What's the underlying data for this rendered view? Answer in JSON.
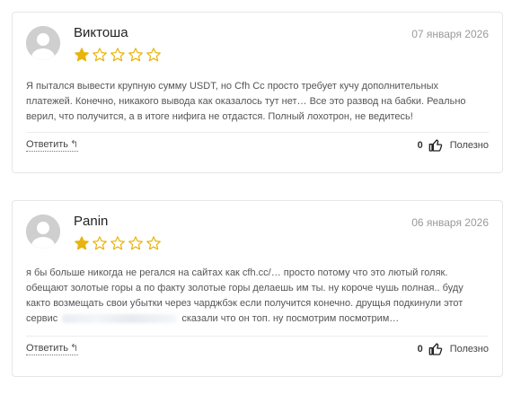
{
  "reviews": [
    {
      "author": "Виктоша",
      "date": "07 января 2026",
      "rating": 1,
      "rating_max": 5,
      "text": "Я пытался вывести крупную сумму USDT, но Cfh Cc просто требует кучу дополнительных платежей. Конечно, никакого вывода как оказалось тут нет… Все это развод на бабки. Реально верил, что получится, а в итоге нифига не отдастся. Полный лохотрон, не ведитесь!",
      "reply_label": "Ответить",
      "helpful_count": "0",
      "helpful_label": "Полезно"
    },
    {
      "author": "Panin",
      "date": "06 января 2026",
      "rating": 1,
      "rating_max": 5,
      "text_before": "я бы больше никогда не регался на сайтах как cfh.cc/… просто потому что это лютый голяк. обещают золотые горы а по факту золотые горы делаешь им ты. ну короче чушь полная.. буду както возмещать свои убытки через чарджбэк если получится конечно. друщья подкинули этот сервис",
      "text_after": "сказали что он топ. ну посмотрим посмотрим…",
      "reply_label": "Ответить",
      "helpful_count": "0",
      "helpful_label": "Полезно"
    }
  ],
  "colors": {
    "star_filled": "#e8b40e",
    "star_outline": "#e8b40e",
    "border": "#e6e6e6"
  },
  "icons": {
    "avatar": "user-avatar-placeholder-icon",
    "reply": "reply-arrow-icon",
    "helpful": "thumbs-up-icon",
    "rating": "star-icon"
  }
}
